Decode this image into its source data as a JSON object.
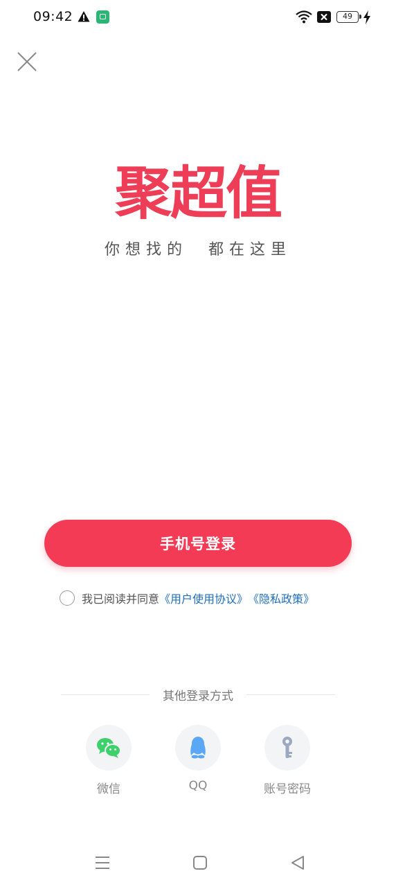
{
  "status_bar": {
    "time": "09:42",
    "battery_level": "49",
    "icons": [
      "warning-icon",
      "app-notification-icon",
      "wifi-icon",
      "x-badge-icon",
      "battery-icon",
      "charging-bolt-icon"
    ]
  },
  "close_icon": "close-icon",
  "brand": {
    "logo_text": "聚超值",
    "slogan": "你想找的  都在这里",
    "color": "#ee3d57"
  },
  "login": {
    "phone_button_label": "手机号登录",
    "button_color": "#f33b55"
  },
  "agreement": {
    "text": "我已阅读并同意",
    "user_agreement_link": "《用户使用协议》",
    "privacy_link": "《隐私政策》",
    "link_color": "#1f6fbf"
  },
  "other_login": {
    "title": "其他登录方式",
    "options": [
      {
        "label": "微信",
        "icon": "wechat-icon",
        "color": "#3dd06b"
      },
      {
        "label": "QQ",
        "icon": "qq-icon",
        "color": "#5aa7f5"
      },
      {
        "label": "账号密码",
        "icon": "key-icon",
        "color": "#9ba8c0"
      }
    ]
  },
  "nav_bar": {
    "buttons": [
      "menu-icon",
      "home-icon",
      "back-icon"
    ]
  }
}
